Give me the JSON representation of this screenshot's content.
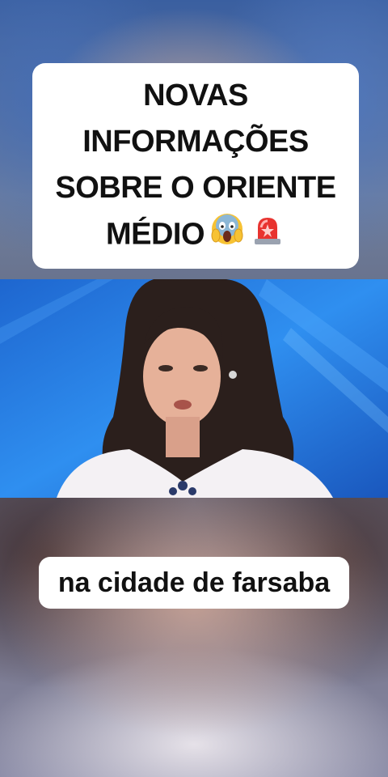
{
  "title": {
    "lines": [
      "NOVAS",
      "INFORMAÇÕES",
      "SOBRE O ORIENTE",
      "MÉDIO"
    ],
    "emojis": [
      "screaming-face-emoji",
      "police-light-emoji"
    ]
  },
  "video": {
    "scene": "news-anchor-presenting"
  },
  "subtitle": {
    "text": "na cidade de farsaba"
  }
}
